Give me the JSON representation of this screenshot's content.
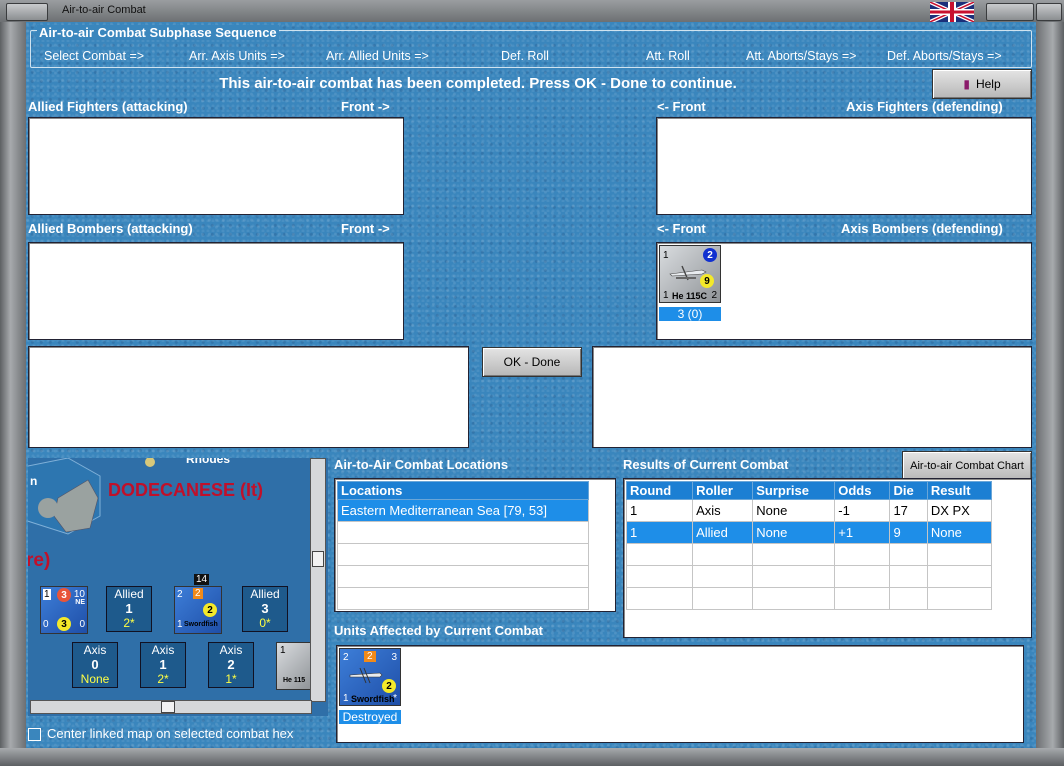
{
  "window": {
    "title": "Air-to-air Combat"
  },
  "sequence": {
    "legend": "Air-to-air Combat Subphase Sequence",
    "steps": [
      "Select Combat =>",
      "Arr. Axis Units =>",
      "Arr. Allied Units =>",
      "Def. Roll",
      "Att. Roll",
      "Att. Aborts/Stays =>",
      "Def. Aborts/Stays =>"
    ]
  },
  "status_text": "This air-to-air combat has been completed.  Press OK - Done to continue.",
  "help_label": "Help",
  "labels": {
    "allied_fighters": "Allied Fighters (attacking)",
    "front_right_1": "Front ->",
    "front_left_1": "<- Front",
    "axis_fighters": "Axis Fighters (defending)",
    "allied_bombers": "Allied Bombers (attacking)",
    "front_right_2": "Front ->",
    "front_left_2": "<- Front",
    "axis_bombers": "Axis Bombers (defending)"
  },
  "axis_bomber_unit": {
    "name": "He 115C",
    "top_left": "1",
    "blue_circle": "2",
    "yellow_circle": "9",
    "bottom_left": "1",
    "bottom_right": "2",
    "caption": "3 (0)"
  },
  "ok_done_label": "OK - Done",
  "map": {
    "place_top": "Rhodes",
    "region": "DODECANESE (It)",
    "edge_letter": "n",
    "edge_text": "re)",
    "unit1": {
      "tl": "1",
      "red": "3",
      "tr": "10",
      "nat": "NE",
      "bl": "0",
      "yel": "3",
      "br": "0"
    },
    "unit2": {
      "tl": "2",
      "orange": "2",
      "yel": "2",
      "bl": "1",
      "name": "Swordfish",
      "stack": "14"
    },
    "unit3": {
      "tl": "1",
      "name": "He 115"
    },
    "cells": [
      {
        "side": "Allied",
        "value": "1",
        "sub": "2*"
      },
      {
        "side": "Allied",
        "value": "3",
        "sub": "0*"
      },
      {
        "side": "Axis",
        "value": "0",
        "sub": "None"
      },
      {
        "side": "Axis",
        "value": "1",
        "sub": "2*"
      },
      {
        "side": "Axis",
        "value": "2",
        "sub": "1*"
      }
    ]
  },
  "center_checkbox_label": "Center linked map on selected combat hex",
  "locations": {
    "title": "Air-to-Air Combat Locations",
    "header": "Locations",
    "rows": [
      "Eastern Mediterranean Sea [79, 53]",
      "",
      "",
      "",
      "",
      ""
    ]
  },
  "results": {
    "title": "Results of Current Combat",
    "chart_button": "Air-to-air Combat Chart",
    "headers": [
      "Round",
      "Roller",
      "Surprise",
      "Odds",
      "Die",
      "Result"
    ],
    "rows": [
      [
        "1",
        "Axis",
        "None",
        "-1",
        "17",
        "DX PX"
      ],
      [
        "1",
        "Allied",
        "None",
        "+1",
        "9",
        "None"
      ],
      [
        "",
        "",
        "",
        "",
        "",
        ""
      ],
      [
        "",
        "",
        "",
        "",
        "",
        ""
      ],
      [
        "",
        "",
        "",
        "",
        "",
        ""
      ]
    ]
  },
  "affected": {
    "title": "Units Affected by Current Combat",
    "unit": {
      "tl": "2",
      "orange": "2",
      "tr": "3",
      "yel": "2",
      "bl": "1",
      "name": "Swordfish",
      "star": "*",
      "caption": "Destroyed"
    }
  }
}
